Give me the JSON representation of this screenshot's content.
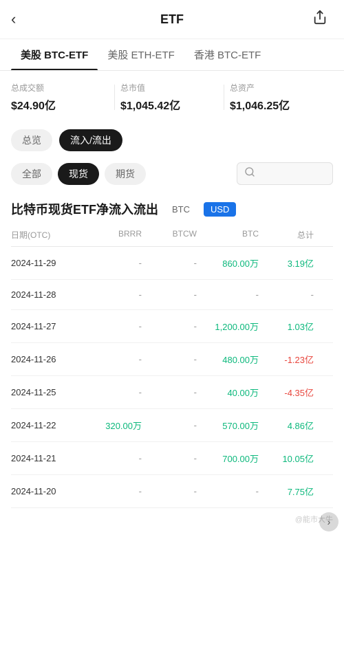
{
  "header": {
    "title": "ETF",
    "back_icon": "‹",
    "share_icon": "⎙"
  },
  "tabs": [
    {
      "id": "btc-etf",
      "label": "美股 BTC-ETF",
      "active": true
    },
    {
      "id": "eth-etf",
      "label": "美股 ETH-ETF",
      "active": false
    },
    {
      "id": "hk-btc-etf",
      "label": "香港 BTC-ETF",
      "active": false
    }
  ],
  "stats": [
    {
      "label": "总成交额",
      "value": "$24.90亿"
    },
    {
      "label": "总市值",
      "value": "$1,045.42亿"
    },
    {
      "label": "总资产",
      "value": "$1,046.25亿"
    }
  ],
  "filter_buttons": [
    {
      "id": "overview",
      "label": "总览",
      "active": false
    },
    {
      "id": "flow",
      "label": "流入/流出",
      "active": true
    }
  ],
  "type_buttons": [
    {
      "id": "all",
      "label": "全部",
      "active": false
    },
    {
      "id": "spot",
      "label": "现货",
      "active": true
    },
    {
      "id": "futures",
      "label": "期货",
      "active": false
    }
  ],
  "search_placeholder": "",
  "section": {
    "title": "比特币现货ETF净流入流出",
    "currency_btc": "BTC",
    "currency_usd": "USD",
    "active_currency": "USD"
  },
  "table": {
    "headers": [
      "日期(OTC)",
      "BRRR",
      "BTCW",
      "BTC",
      "总计"
    ],
    "rows": [
      {
        "date": "2024-11-29",
        "brrr": "-",
        "btcw": "-",
        "btc": "860.00万",
        "btc_class": "green",
        "total": "3.19亿",
        "total_class": "green"
      },
      {
        "date": "2024-11-28",
        "brrr": "-",
        "btcw": "-",
        "btc": "-",
        "btc_class": "dash",
        "total": "-",
        "total_class": "dash"
      },
      {
        "date": "2024-11-27",
        "brrr": "-",
        "btcw": "-",
        "btc": "1,200.00万",
        "btc_class": "green",
        "total": "1.03亿",
        "total_class": "green"
      },
      {
        "date": "2024-11-26",
        "brrr": "-",
        "btcw": "-",
        "btc": "480.00万",
        "btc_class": "green",
        "total": "-1.23亿",
        "total_class": "red"
      },
      {
        "date": "2024-11-25",
        "brrr": "-",
        "btcw": "-",
        "btc": "40.00万",
        "btc_class": "green",
        "total": "-4.35亿",
        "total_class": "red"
      },
      {
        "date": "2024-11-22",
        "brrr": "320.00万",
        "btcw": "-",
        "btc": "570.00万",
        "btc_class": "green",
        "total": "4.86亿",
        "total_class": "green"
      },
      {
        "date": "2024-11-21",
        "brrr": "-",
        "btcw": "-",
        "btc": "700.00万",
        "btc_class": "green",
        "total": "10.05亿",
        "total_class": "green"
      },
      {
        "date": "2024-11-20",
        "brrr": "-",
        "btcw": "-",
        "btc": "-",
        "btc_class": "dash",
        "total": "7.75亿",
        "total_class": "green"
      }
    ]
  },
  "watermark": "@能市大牛"
}
